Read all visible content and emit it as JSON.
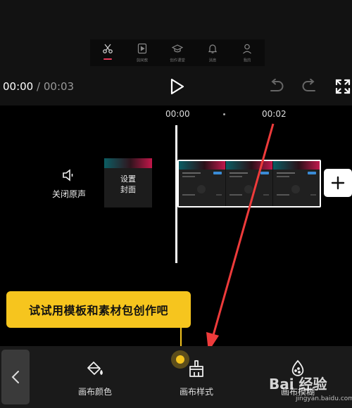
{
  "tabs": [
    {
      "label": "",
      "icon": "scissors-icon",
      "active": true
    },
    {
      "label": "剪同款",
      "icon": "template-icon"
    },
    {
      "label": "创作课堂",
      "icon": "graduation-cap-icon"
    },
    {
      "label": "消息",
      "icon": "bell-icon"
    },
    {
      "label": "我的",
      "icon": "user-icon"
    }
  ],
  "player": {
    "current_time": "00:00",
    "separator": "/",
    "total_time": "00:03"
  },
  "timeline": {
    "tick_0": "00:00",
    "tick_1": "00:02"
  },
  "mute": {
    "label": "关闭原声"
  },
  "cover": {
    "line1": "设置",
    "line2": "封面"
  },
  "tooltip": {
    "text": "试试用模板和素材包创作吧"
  },
  "tools": [
    {
      "label": "画布颜色",
      "icon": "paint-bucket-icon"
    },
    {
      "label": "画布样式",
      "icon": "brush-icon"
    },
    {
      "label": "画布模糊",
      "icon": "blur-drop-icon"
    }
  ],
  "watermark": {
    "main": "Bai 经验",
    "sub": "jingyan.baidu.com"
  },
  "colors": {
    "accent": "#e83a5a",
    "tooltip": "#f6c51e",
    "arrow": "#ee3b3b"
  }
}
